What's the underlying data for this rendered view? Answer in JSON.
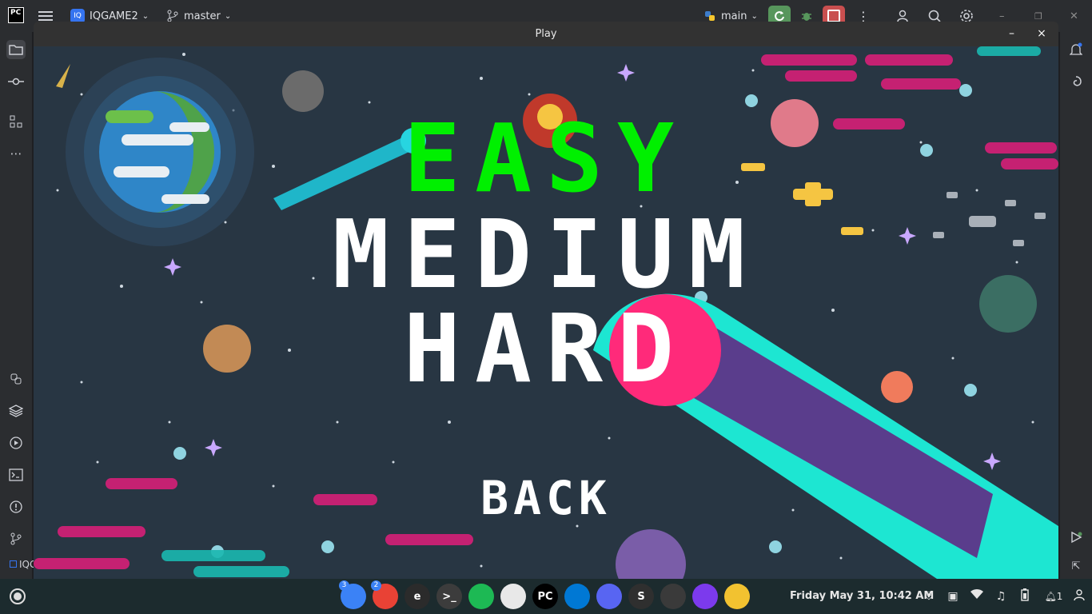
{
  "ide": {
    "logo": "PC",
    "project_badge": "IQ",
    "project_name": "IQGAME2",
    "branch": "master",
    "run_config": "main",
    "bottom_project_label": "IQG"
  },
  "game_window": {
    "title": "Play",
    "minimize_glyph": "–",
    "close_glyph": "×"
  },
  "menu": {
    "easy": "EASY",
    "medium": "MEDIUM",
    "hard": "HARD",
    "back": "BACK"
  },
  "colors": {
    "easy": "#00f000",
    "menu_text": "#ffffff",
    "space_bg": "#283643"
  },
  "taskbar": {
    "apps": [
      {
        "name": "files",
        "label": "",
        "badge": "3",
        "color": "#3b82f6"
      },
      {
        "name": "chrome",
        "label": "",
        "badge": "2",
        "color": "#e94235"
      },
      {
        "name": "editor",
        "label": "e",
        "badge": "",
        "color": "#2b2b2b"
      },
      {
        "name": "terminal",
        "label": ">_",
        "badge": "",
        "color": "#3c3c3c"
      },
      {
        "name": "spotify",
        "label": "",
        "badge": "",
        "color": "#1db954"
      },
      {
        "name": "stacks",
        "label": "",
        "badge": "",
        "color": "#e8e8e8"
      },
      {
        "name": "pycharm",
        "label": "PC",
        "badge": "",
        "color": "#000000"
      },
      {
        "name": "vscode",
        "label": "",
        "badge": "",
        "color": "#0078d4"
      },
      {
        "name": "discord",
        "label": "",
        "badge": "",
        "color": "#5865f2"
      },
      {
        "name": "s-app",
        "label": "S",
        "badge": "",
        "color": "#2f2f2f"
      },
      {
        "name": "video",
        "label": "",
        "badge": "",
        "color": "#3a3a3a"
      },
      {
        "name": "obsidian",
        "label": "",
        "badge": "",
        "color": "#7c3aed"
      },
      {
        "name": "game",
        "label": "",
        "badge": "",
        "color": "#f2c230"
      }
    ],
    "clock": "Friday May 31, 10:42 AM",
    "notifications_count": "1"
  }
}
